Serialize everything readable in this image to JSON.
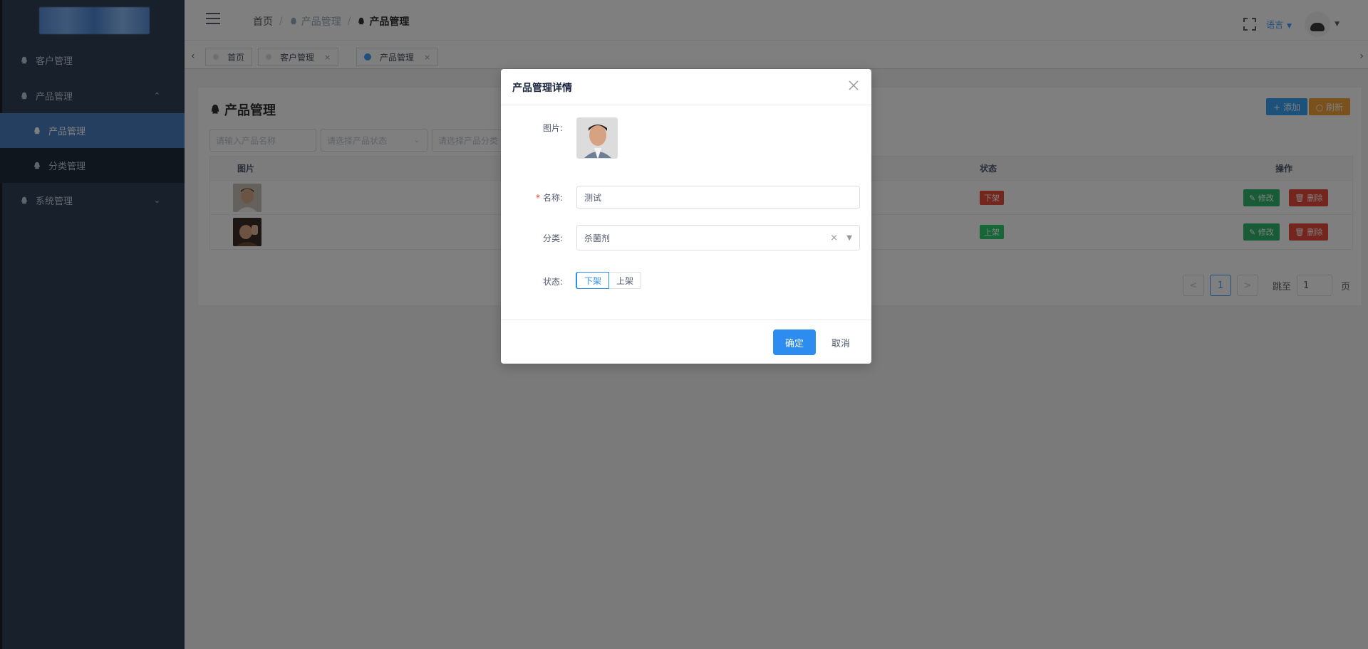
{
  "sidebar": {
    "items": [
      {
        "label": "客户管理",
        "icon": "qq-icon"
      },
      {
        "label": "产品管理",
        "icon": "qq-icon",
        "expanded": true,
        "arrow": "⌃"
      },
      {
        "label": "产品管理",
        "icon": "qq-icon",
        "active": true
      },
      {
        "label": "分类管理",
        "icon": "qq-icon"
      },
      {
        "label": "系统管理",
        "icon": "qq-icon",
        "arrow": "⌄"
      }
    ]
  },
  "navbar": {
    "breadcrumb": [
      "首页",
      "产品管理",
      "产品管理"
    ],
    "lang_label": "语言"
  },
  "tags": [
    {
      "label": "首页"
    },
    {
      "label": "客户管理",
      "close": "×"
    },
    {
      "label": "产品管理",
      "close": "×",
      "active": true
    }
  ],
  "page": {
    "title": "产品管理",
    "add_label": "+ 添加",
    "refresh_label": "○ 刷新",
    "filters": {
      "name_placeholder": "请输入产品名称",
      "status_placeholder": "请选择产品状态",
      "category_placeholder": "请选择产品分类"
    },
    "table": {
      "headers": {
        "image": "图片",
        "status": "状态",
        "actions": "操作"
      },
      "rows": [
        {
          "status": "下架",
          "edit": "✎ 修改",
          "delete": "🗑 删除"
        },
        {
          "status": "上架",
          "edit": "✎ 修改",
          "delete": "🗑 删除"
        }
      ]
    },
    "pagination": {
      "prev": "<",
      "current": "1",
      "next": ">",
      "jump_label": "跳至",
      "jump_value": "1",
      "page_suffix": "页"
    }
  },
  "modal": {
    "title": "产品管理详情",
    "fields": {
      "image_label": "图片:",
      "name_label": "名称:",
      "name_value": "测试",
      "category_label": "分类:",
      "category_value": "杀菌剂",
      "status_label": "状态:",
      "status_options": [
        "下架",
        "上架"
      ],
      "status_selected": "下架"
    },
    "ok_label": "确定",
    "cancel_label": "取消"
  },
  "colors": {
    "sidebar_bg": "#304156",
    "active_menu": "#4a7fc1",
    "primary": "#2d8cf0",
    "status_down": "#e74c3c",
    "status_up": "#2ecc71"
  }
}
